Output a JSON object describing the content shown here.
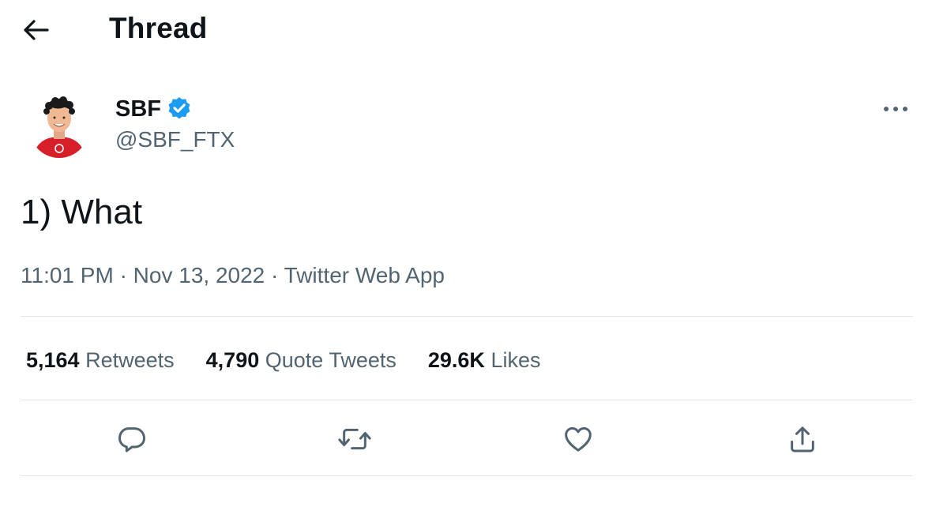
{
  "header": {
    "title": "Thread"
  },
  "author": {
    "name": "SBF",
    "handle": "@SBF_FTX",
    "verified": true
  },
  "tweet": {
    "text": "1) What",
    "time": "11:01 PM",
    "date": "Nov 13, 2022",
    "source": "Twitter Web App",
    "separator": "·"
  },
  "stats": [
    {
      "count": "5,164",
      "label": "Retweets"
    },
    {
      "count": "4,790",
      "label": "Quote Tweets"
    },
    {
      "count": "29.6K",
      "label": "Likes"
    }
  ],
  "actions": [
    "reply-icon",
    "retweet-icon",
    "like-icon",
    "share-icon"
  ],
  "colors": {
    "text": "#0f1419",
    "secondary": "#536471",
    "divider": "#e1e6ea",
    "verified": "#1d9bf0",
    "avatar_shirt": "#d71f2a"
  }
}
